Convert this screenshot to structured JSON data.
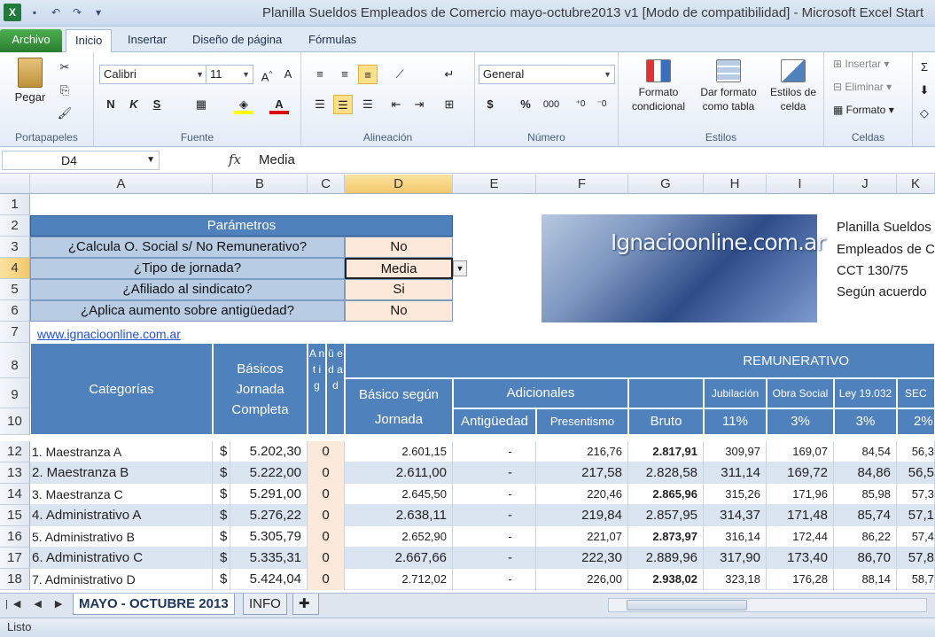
{
  "window": {
    "title": "Planilla Sueldos Empleados de Comercio mayo-octubre2013 v1  [Modo de compatibilidad]  -  Microsoft Excel Start",
    "app_icon": "X"
  },
  "ribbon_tabs": [
    "Archivo",
    "Inicio",
    "Insertar",
    "Diseño de página",
    "Fórmulas"
  ],
  "ribbon": {
    "paste_label": "Pegar",
    "clipboard_label": "Portapapeles",
    "font_name": "Calibri",
    "font_size": "11",
    "bold": "N",
    "italic": "K",
    "underline": "S",
    "font_label": "Fuente",
    "alignment_label": "Alineación",
    "number_format": "General",
    "number_label": "Número",
    "cond_format": "Formato condicional",
    "format_table": "Dar formato como tabla",
    "cell_styles": "Estilos de celda",
    "styles_label": "Estilos",
    "insert": "Insertar",
    "delete": "Eliminar",
    "format": "Formato",
    "cells_label": "Celdas",
    "currency": "$",
    "percent": "%",
    "thousands": "000"
  },
  "formula_bar": {
    "name_box": "D4",
    "fx": "fx",
    "value": "Media"
  },
  "columns": [
    "A",
    "B",
    "C",
    "D",
    "E",
    "F",
    "G",
    "H",
    "I",
    "J",
    "K"
  ],
  "row_numbers": [
    "1",
    "2",
    "3",
    "4",
    "5",
    "6",
    "7",
    "8",
    "9",
    "10",
    "12",
    "13",
    "14",
    "15",
    "16",
    "17",
    "18"
  ],
  "params": {
    "header": "Parámetros",
    "q1": "¿Calcula O. Social s/ No Remunerativo?",
    "v1": "No",
    "q2": "¿Tipo de jornada?",
    "v2": "Media",
    "q3": "¿Afiliado al sindicato?",
    "v3": "Si",
    "q4": "¿Aplica aumento sobre antigüedad?",
    "v4": "No"
  },
  "link": "www.ignacioonline.com.ar",
  "banner_text": "Ignacioonline.com.ar",
  "side_text": [
    "Planilla Sueldos",
    "Empleados de C",
    "CCT 130/75",
    "Según acuerdo"
  ],
  "headers": {
    "categorias": "Categorías",
    "basicos": "Básicos Jornada Completa",
    "antig": "A n t i g",
    "antig2": "ü e d a d",
    "basico_jornada": "Básico según Jornada",
    "adicionales": "Adicionales",
    "antiguedad": "Antigüedad",
    "presentismo": "Presentismo",
    "remunerativo": "REMUNERATIVO",
    "bruto": "Bruto",
    "jubilacion": "Jubilación",
    "obra_social": "Obra Social",
    "ley": "Ley 19.032",
    "sec": "SEC",
    "jub_pct": "11%",
    "os_pct": "3%",
    "ley_pct": "3%",
    "sec_pct": "2%"
  },
  "rows": [
    {
      "cat": "1. Maestranza A",
      "cur": "$",
      "basico": "5.202,30",
      "antig": "0",
      "bj": "2.601,15",
      "ant": "-",
      "pres": "216,76",
      "bruto": "2.817,91",
      "jub": "309,97",
      "os": "169,07",
      "ley": "84,54",
      "sec": "56,3"
    },
    {
      "cat": "2. Maestranza B",
      "cur": "$",
      "basico": "5.222,00",
      "antig": "0",
      "bj": "2.611,00",
      "ant": "-",
      "pres": "217,58",
      "bruto": "2.828,58",
      "jub": "311,14",
      "os": "169,72",
      "ley": "84,86",
      "sec": "56,5"
    },
    {
      "cat": "3. Maestranza C",
      "cur": "$",
      "basico": "5.291,00",
      "antig": "0",
      "bj": "2.645,50",
      "ant": "-",
      "pres": "220,46",
      "bruto": "2.865,96",
      "jub": "315,26",
      "os": "171,96",
      "ley": "85,98",
      "sec": "57,3"
    },
    {
      "cat": "4. Administrativo A",
      "cur": "$",
      "basico": "5.276,22",
      "antig": "0",
      "bj": "2.638,11",
      "ant": "-",
      "pres": "219,84",
      "bruto": "2.857,95",
      "jub": "314,37",
      "os": "171,48",
      "ley": "85,74",
      "sec": "57,1"
    },
    {
      "cat": "5. Administrativo B",
      "cur": "$",
      "basico": "5.305,79",
      "antig": "0",
      "bj": "2.652,90",
      "ant": "-",
      "pres": "221,07",
      "bruto": "2.873,97",
      "jub": "316,14",
      "os": "172,44",
      "ley": "86,22",
      "sec": "57,4"
    },
    {
      "cat": "6. Administrativo C",
      "cur": "$",
      "basico": "5.335,31",
      "antig": "0",
      "bj": "2.667,66",
      "ant": "-",
      "pres": "222,30",
      "bruto": "2.889,96",
      "jub": "317,90",
      "os": "173,40",
      "ley": "86,70",
      "sec": "57,8"
    },
    {
      "cat": "7. Administrativo D",
      "cur": "$",
      "basico": "5.424,04",
      "antig": "0",
      "bj": "2.712,02",
      "ant": "-",
      "pres": "226,00",
      "bruto": "2.938,02",
      "jub": "323,18",
      "os": "176,28",
      "ley": "88,14",
      "sec": "58,7"
    }
  ],
  "sheet_tabs": [
    "MAYO - OCTUBRE 2013",
    "INFO"
  ],
  "status": "Listo"
}
